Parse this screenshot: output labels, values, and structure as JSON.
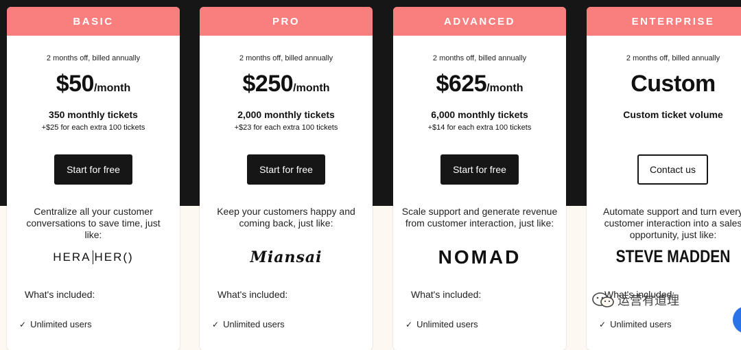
{
  "plans": [
    {
      "name": "BASIC",
      "billing": "2 months off, billed annually",
      "price": "$50",
      "per": "/month",
      "tickets": "350 monthly tickets",
      "extra": "+$25 for each extra 100 tickets",
      "cta": "Start for free",
      "description": "Centralize all your customer conversations to save time, just like:",
      "logo_text_a": "HERA",
      "logo_text_b": "HER()",
      "included": "What's included:",
      "feature": "Unlimited users"
    },
    {
      "name": "PRO",
      "billing": "2 months off, billed annually",
      "price": "$250",
      "per": "/month",
      "tickets": "2,000 monthly tickets",
      "extra": "+$23 for each extra 100 tickets",
      "cta": "Start for free",
      "description": "Keep your customers happy and coming back, just like:",
      "logo_text": "Miansai",
      "included": "What's included:",
      "feature": "Unlimited users"
    },
    {
      "name": "ADVANCED",
      "billing": "2 months off, billed annually",
      "price": "$625",
      "per": "/month",
      "tickets": "6,000 monthly tickets",
      "extra": "+$14 for each extra 100 tickets",
      "cta": "Start for free",
      "description": "Scale support and generate revenue from customer interaction, just like:",
      "logo_text": "NOMAD",
      "included": "What's included:",
      "feature": "Unlimited users"
    },
    {
      "name": "ENTERPRISE",
      "billing": "2 months off, billed annually",
      "price": "Custom",
      "tickets": "Custom ticket volume",
      "cta": "Contact us",
      "description": "Automate support and turn every customer interaction into a sales opportunity, just like:",
      "logo_text": "STEVE MADDEN",
      "included": "What's included:",
      "feature": "Unlimited users"
    }
  ],
  "watermark": "运营有道理",
  "colors": {
    "header": "#f97e7e",
    "dark": "#161616",
    "cream": "#fdf8f2"
  }
}
